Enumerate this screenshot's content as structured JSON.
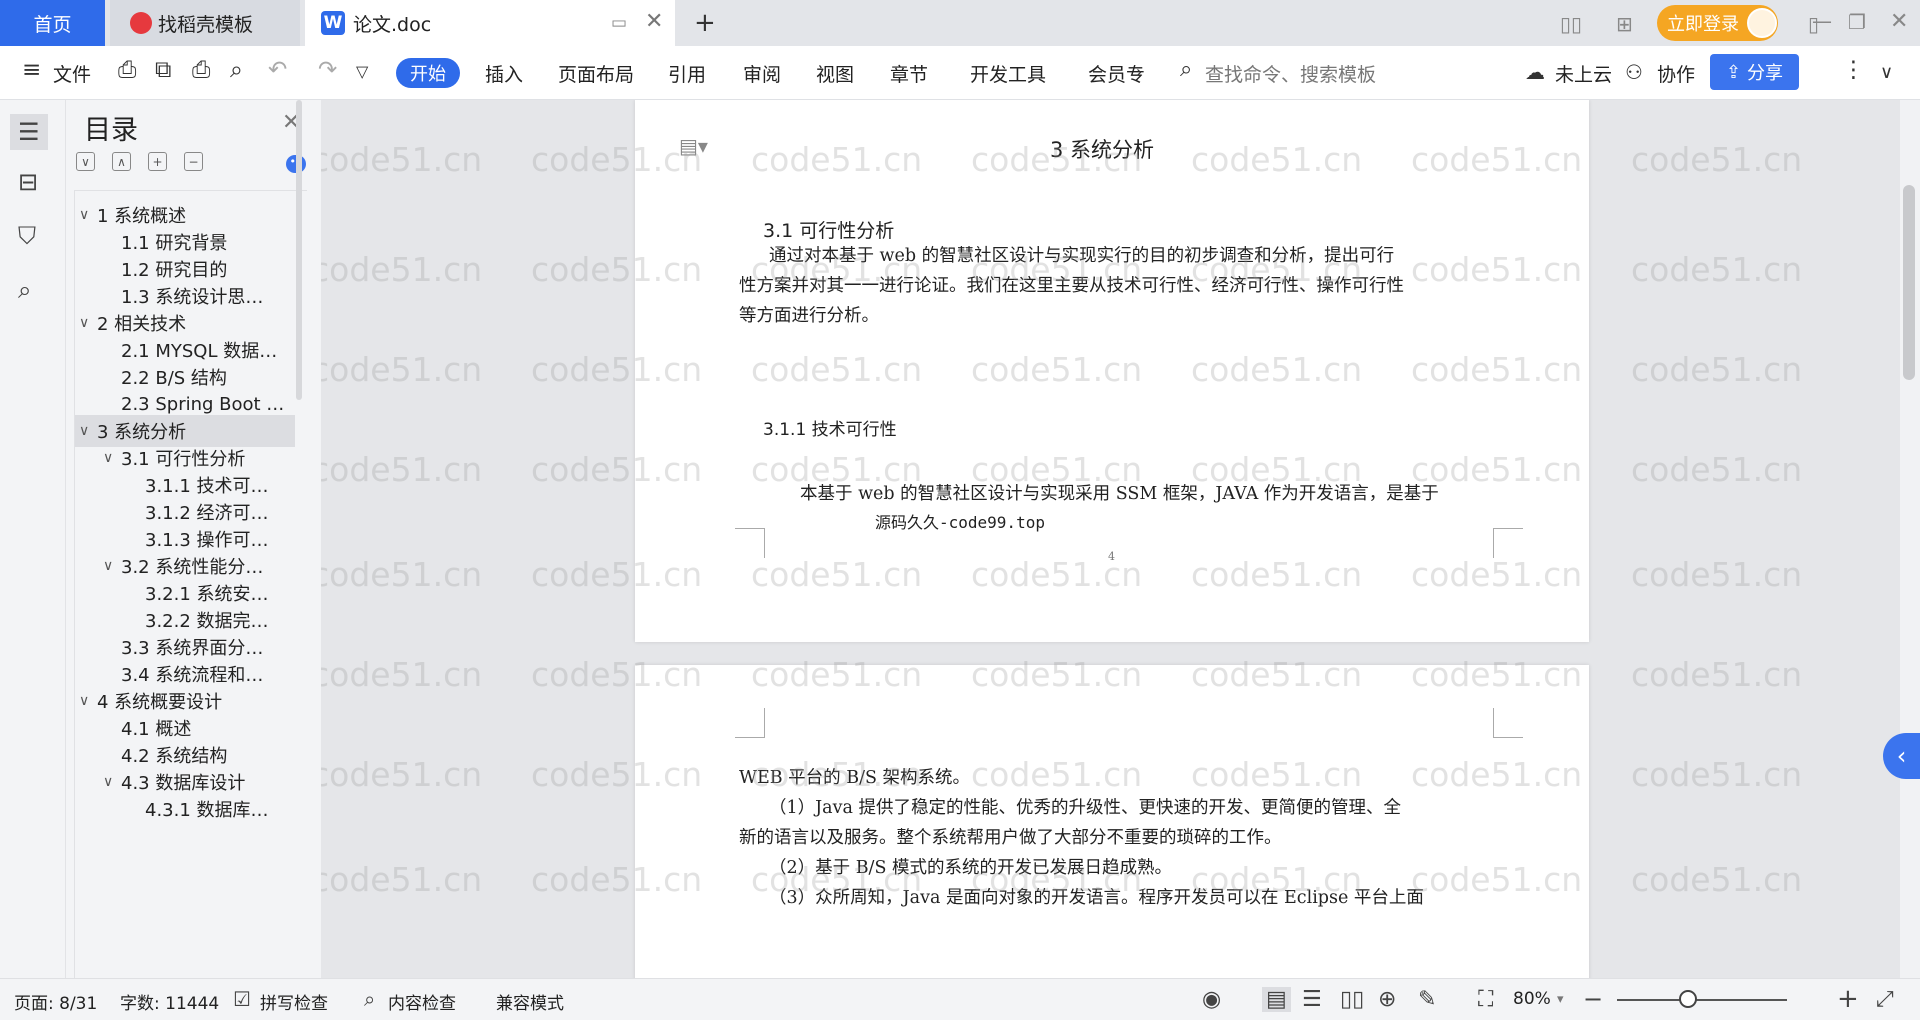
{
  "tabs": {
    "home": "首页",
    "templates": "找稻壳模板",
    "document": "论文.doc",
    "add": "+"
  },
  "header": {
    "login": "立即登录"
  },
  "ribbon": {
    "menu": "文件",
    "tabs": [
      "开始",
      "插入",
      "页面布局",
      "引用",
      "审阅",
      "视图",
      "章节",
      "开发工具",
      "会员专"
    ],
    "search_placeholder": "查找命令、搜索模板",
    "cloud": "未上云",
    "collaborate": "协作",
    "share": "分享"
  },
  "outline": {
    "title": "目录",
    "items": [
      {
        "label": "1 系统概述",
        "level": 1,
        "caret": "∨"
      },
      {
        "label": "1.1  研究背景",
        "level": 2,
        "caret": ""
      },
      {
        "label": "1.2 研究目的",
        "level": 2,
        "caret": ""
      },
      {
        "label": "1.3 系统设计思…",
        "level": 2,
        "caret": ""
      },
      {
        "label": "2 相关技术",
        "level": 1,
        "caret": "∨"
      },
      {
        "label": "2.1 MYSQL 数据…",
        "level": 2,
        "caret": ""
      },
      {
        "label": "2.2 B/S 结构",
        "level": 2,
        "caret": ""
      },
      {
        "label": "2.3 Spring Boot …",
        "level": 2,
        "caret": ""
      },
      {
        "label": "3 系统分析",
        "level": 1,
        "caret": "∨",
        "active": true
      },
      {
        "label": "3.1 可行性分析",
        "level": 2,
        "caret": "∨"
      },
      {
        "label": "3.1.1 技术可…",
        "level": 3,
        "caret": ""
      },
      {
        "label": "3.1.2 经济可…",
        "level": 3,
        "caret": ""
      },
      {
        "label": "3.1.3 操作可…",
        "level": 3,
        "caret": ""
      },
      {
        "label": "3.2 系统性能分…",
        "level": 2,
        "caret": "∨"
      },
      {
        "label": "3.2.1  系统安…",
        "level": 3,
        "caret": ""
      },
      {
        "label": "3.2.2  数据完…",
        "level": 3,
        "caret": ""
      },
      {
        "label": "3.3 系统界面分…",
        "level": 2,
        "caret": ""
      },
      {
        "label": "3.4 系统流程和…",
        "level": 2,
        "caret": ""
      },
      {
        "label": "4 系统概要设计",
        "level": 1,
        "caret": "∨"
      },
      {
        "label": "4.1 概述",
        "level": 2,
        "caret": ""
      },
      {
        "label": "4.2 系统结构",
        "level": 2,
        "caret": ""
      },
      {
        "label": "4.3 数据库设计",
        "level": 2,
        "caret": "∨"
      },
      {
        "label": "4.3.1 数据库…",
        "level": 3,
        "caret": ""
      }
    ]
  },
  "document": {
    "page1": {
      "chapter": "3 系统分析",
      "section": "3.1 可行性分析",
      "para1": [
        "通过对本基于 web 的智慧社区设计与实现实行的目的初步调查和分析，提出可行",
        "性方案并对其一一进行论证。我们在这里主要从技术可行性、经济可行性、操作可行性",
        "等方面进行分析。"
      ],
      "subsection": "3.1.1 技术可行性",
      "para2": "本基于 web 的智慧社区设计与实现采用 SSM 框架，JAVA 作为开发语言，是基于",
      "footer_note": "源码久久-code99.top",
      "page_number": "4"
    },
    "page2": {
      "lines": [
        "WEB 平台的 B/S 架构系统。",
        "（1）Java 提供了稳定的性能、优秀的升级性、更快速的开发、更简便的管理、全",
        "新的语言以及服务。整个系统帮用户做了大部分不重要的琐碎的工作。",
        "（2）基于 B/S 模式的系统的开发已发展日趋成熟。",
        "（3）众所周知，Java 是面向对象的开发语言。程序开发员可以在 Eclipse 平台上面"
      ]
    }
  },
  "watermark": "code51.cn",
  "statusbar": {
    "page": "页面: 8/31",
    "words": "字数: 11444",
    "spell": "拼写检查",
    "content": "内容检查",
    "compat": "兼容模式",
    "zoom": "80%",
    "zoom_level": 0.42
  }
}
